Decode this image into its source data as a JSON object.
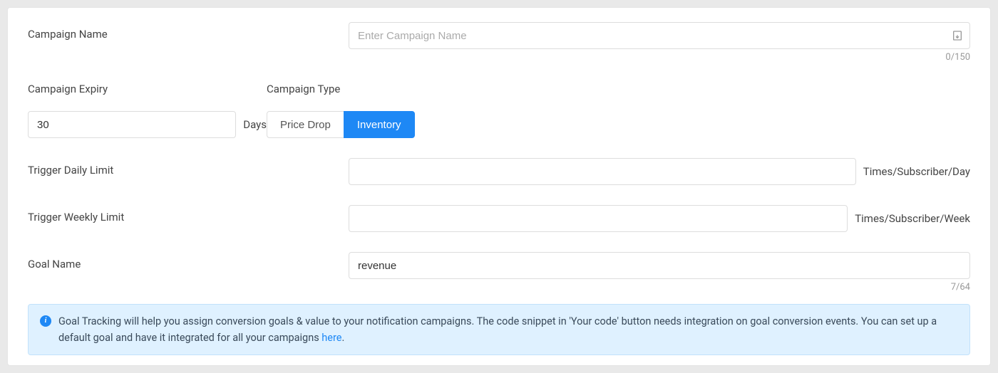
{
  "campaign_name": {
    "label": "Campaign Name",
    "placeholder": "Enter Campaign Name",
    "value": "",
    "counter": "0/150"
  },
  "campaign_expiry": {
    "label": "Campaign Expiry",
    "value": "30",
    "unit": "Days"
  },
  "campaign_type": {
    "label": "Campaign Type",
    "options": {
      "price_drop": "Price Drop",
      "inventory": "Inventory"
    },
    "selected": "Inventory"
  },
  "trigger_daily": {
    "label": "Trigger Daily Limit",
    "value": "",
    "suffix": "Times/Subscriber/Day"
  },
  "trigger_weekly": {
    "label": "Trigger Weekly Limit",
    "value": "",
    "suffix": "Times/Subscriber/Week"
  },
  "goal_name": {
    "label": "Goal Name",
    "value": "revenue",
    "counter": "7/64"
  },
  "info": {
    "text_part1": "Goal Tracking will help you assign conversion goals & value to your notification campaigns. The code snippet in 'Your code' button needs integration on goal conversion events. You can set up a default goal and have it integrated for all your campaigns ",
    "link_text": "here",
    "text_part2": "."
  }
}
